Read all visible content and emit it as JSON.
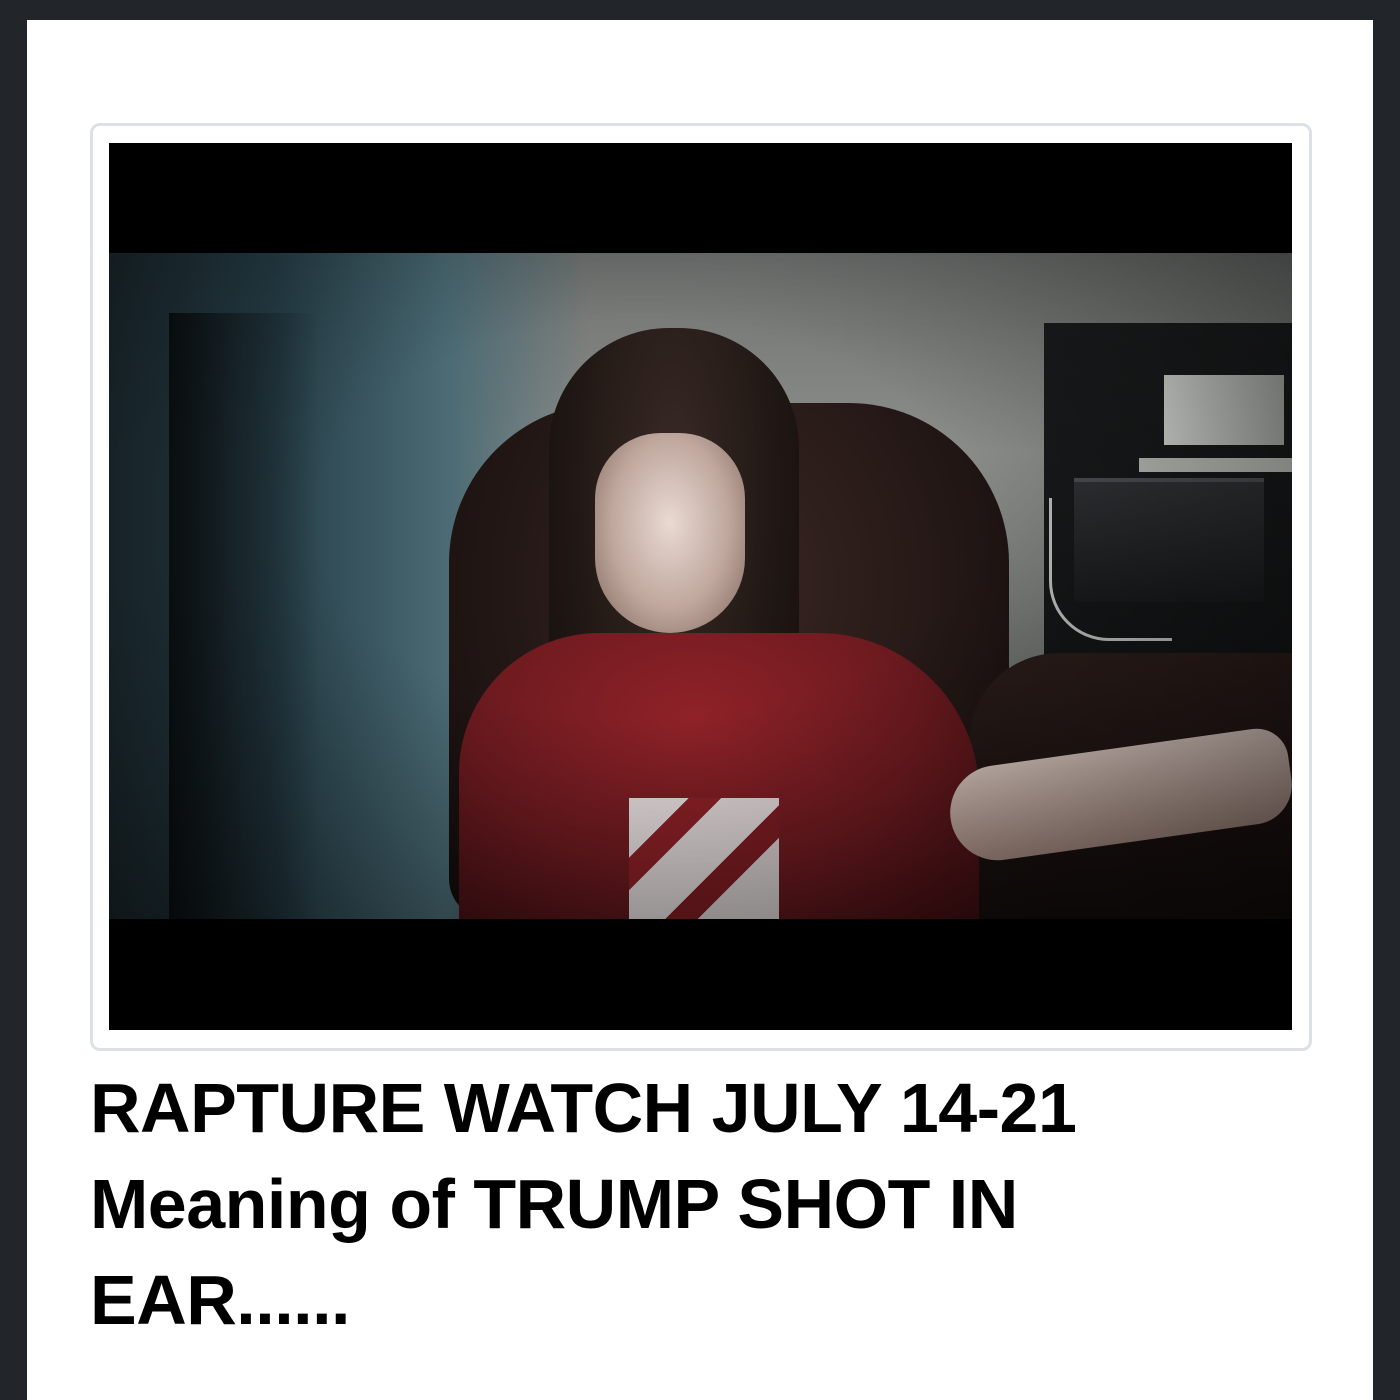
{
  "post": {
    "title_lines": [
      "RAPTURE WATCH JULY 14-21",
      "Meaning of TRUMP SHOT IN",
      "EAR......"
    ]
  },
  "colors": {
    "page_background": "#22262b",
    "card_background": "#ffffff",
    "thumbnail_border": "#dde1e6",
    "letterbox": "#000000",
    "title_text": "#000000"
  }
}
